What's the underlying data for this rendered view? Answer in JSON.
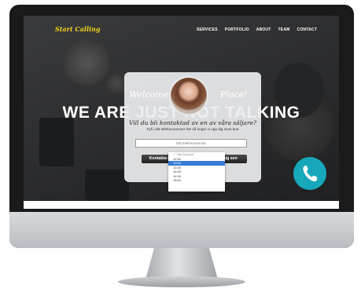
{
  "site": {
    "logo": "Start Calling",
    "nav": [
      "SERVICES",
      "PORTFOLIO",
      "ABOUT",
      "TEAM",
      "CONTACT"
    ],
    "hero_title": "WE ARE JUST NOT TALKING"
  },
  "popup": {
    "welcome_left": "Welcome",
    "welcome_right": "Place!",
    "question": "Vill du bli kontaktad av en av våra säljare?",
    "subtext": "Fyll i ditt telefonnummer här så ringer vi upp dig inom kort",
    "phone_placeholder": "Ditt telefonnummer",
    "button_now": "Kontakta mig nu",
    "button_later": "Kontakta mig sen"
  },
  "dropdown": {
    "header": "✓ Välj tidpunkt",
    "options": [
      "11:30",
      "13:00",
      "13:30",
      "14:00",
      "14:30",
      "15:00"
    ],
    "selected_index": 1
  },
  "icons": {
    "call": "phone-icon"
  },
  "colors": {
    "logo": "#f2d21b",
    "call_button": "#17a8ba",
    "selection": "#3a7bd5"
  }
}
